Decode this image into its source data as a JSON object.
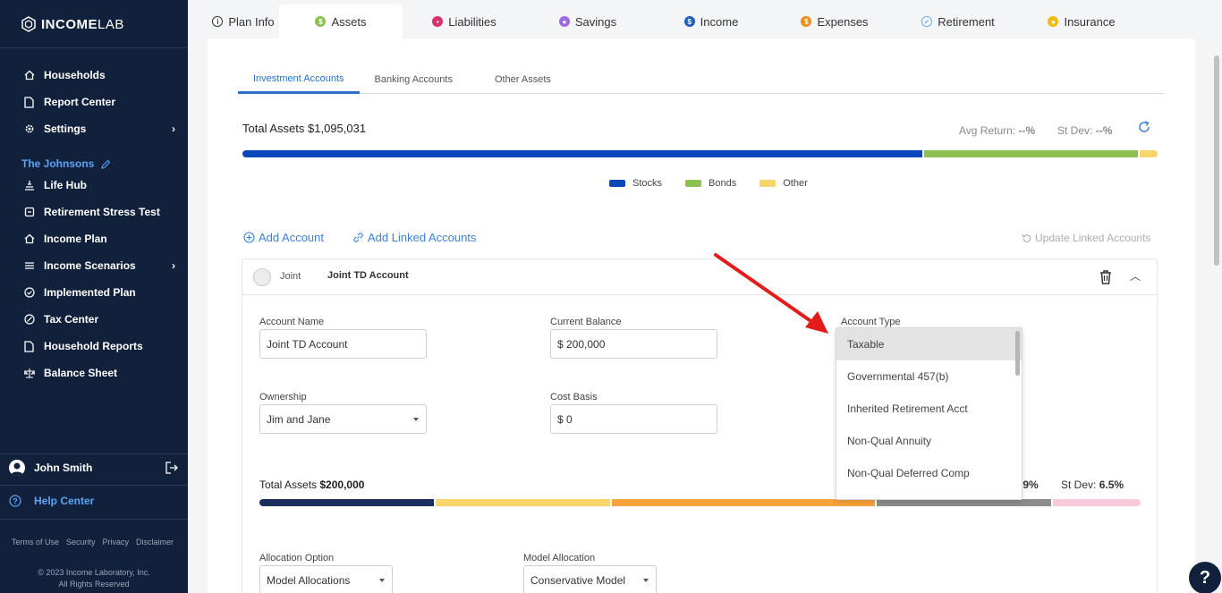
{
  "app": {
    "brand_bold": "INCOME",
    "brand_light": "LAB"
  },
  "sidebar": {
    "items": [
      {
        "label": "Households",
        "icon": "home-icon"
      },
      {
        "label": "Report Center",
        "icon": "document-icon"
      },
      {
        "label": "Settings",
        "icon": "gear-icon",
        "has_submenu": true
      }
    ],
    "client_name": "The Johnsons",
    "client_items": [
      {
        "label": "Life Hub",
        "icon": "lifehub-icon"
      },
      {
        "label": "Retirement Stress Test",
        "icon": "stress-test-icon"
      },
      {
        "label": "Income Plan",
        "icon": "home-icon"
      },
      {
        "label": "Income Scenarios",
        "icon": "menu-icon",
        "has_submenu": true
      },
      {
        "label": "Implemented Plan",
        "icon": "check-circle-icon"
      },
      {
        "label": "Tax Center",
        "icon": "tax-icon"
      },
      {
        "label": "Household Reports",
        "icon": "document-icon"
      },
      {
        "label": "Balance Sheet",
        "icon": "scale-icon"
      }
    ],
    "user_name": "John Smith",
    "help_center": "Help Center",
    "footer_links": [
      "Terms of Use",
      "Security",
      "Privacy",
      "Disclaimer"
    ],
    "copyright_line1": "© 2023 Income Laboratory, Inc.",
    "copyright_line2": "All Rights Reserved"
  },
  "top_tabs": [
    {
      "label": "Plan Info",
      "color": "#333333",
      "active": false
    },
    {
      "label": "Assets",
      "color": "#8cc152",
      "active": true
    },
    {
      "label": "Liabilities",
      "color": "#d6336c",
      "active": false
    },
    {
      "label": "Savings",
      "color": "#9c6ade",
      "active": false
    },
    {
      "label": "Income",
      "color": "#1f5fbf",
      "active": false
    },
    {
      "label": "Expenses",
      "color": "#f08c1a",
      "active": false
    },
    {
      "label": "Retirement",
      "color": "#6aa8e8",
      "active": false
    },
    {
      "label": "Insurance",
      "color": "#f2b90f",
      "active": false
    }
  ],
  "sub_tabs": [
    "Investment Accounts",
    "Banking Accounts",
    "Other Assets"
  ],
  "summary": {
    "total_label": "Total Assets",
    "total_value": "$1,095,031",
    "avg_return_label": "Avg Return:",
    "avg_return_value": "--%",
    "st_dev_label": "St Dev:",
    "st_dev_value": "--%",
    "allocation": [
      {
        "name": "Stocks",
        "pct": 74.5,
        "color": "#0b47b8"
      },
      {
        "name": "Bonds",
        "pct": 23.5,
        "color": "#8cc152"
      },
      {
        "name": "Other",
        "pct": 2.0,
        "color": "#f7d56a"
      }
    ]
  },
  "actions": {
    "add_account": "Add Account",
    "add_linked": "Add Linked Accounts",
    "update_linked": "Update Linked Accounts"
  },
  "account": {
    "owner": "Joint",
    "title": "Joint TD Account",
    "account_name_label": "Account Name",
    "account_name_value": "Joint TD Account",
    "current_balance_label": "Current Balance",
    "current_balance_value": "$ 200,000",
    "account_type_label": "Account Type",
    "ownership_label": "Ownership",
    "ownership_value": "Jim and Jane",
    "cost_basis_label": "Cost Basis",
    "cost_basis_value": "$ 0",
    "sub_total_label": "Total Assets",
    "sub_total_value": "$200,000",
    "sub_avg_value": ".9%",
    "sub_stdev_label": "St Dev:",
    "sub_stdev_value": "6.5%",
    "sub_allocation": [
      {
        "pct": 20.0,
        "color": "#1b2f5e"
      },
      {
        "pct": 20.0,
        "color": "#fbd56b"
      },
      {
        "pct": 30.0,
        "color": "#f7a23a"
      },
      {
        "pct": 20.0,
        "color": "#8c8c8c"
      },
      {
        "pct": 10.0,
        "color": "#f9c9dc"
      }
    ],
    "allocation_option_label": "Allocation Option",
    "allocation_option_value": "Model Allocations",
    "model_allocation_label": "Model Allocation",
    "model_allocation_value": "Conservative Model"
  },
  "account_type_dropdown": {
    "options": [
      "Taxable",
      "Governmental 457(b)",
      "Inherited Retirement Acct",
      "Non-Qual Annuity",
      "Non-Qual Deferred Comp"
    ],
    "selected_index": 0
  },
  "help_fab": "?"
}
